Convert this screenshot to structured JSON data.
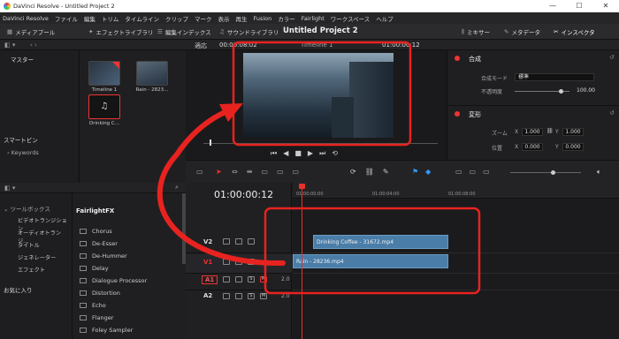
{
  "window": {
    "title": "DaVinci Resolve - Untitled Project 2",
    "minimize": "—",
    "maximize": "☐",
    "close": "✕"
  },
  "menu": [
    "DaVinci Resolve",
    "ファイル",
    "編集",
    "トリム",
    "タイムライン",
    "クリップ",
    "マーク",
    "表示",
    "再生",
    "Fusion",
    "カラー",
    "Fairlight",
    "ワークスペース",
    "ヘルプ"
  ],
  "toolbar": {
    "media_pool": "メディアプール",
    "effects_library": "エフェクトライブラリ",
    "edit_index": "編集インデックス",
    "sound_library": "サウンドライブラリ",
    "project_title": "Untitled Project 2",
    "mixer": "ミキサー",
    "metadata": "メタデータ",
    "inspector": "インスペクタ"
  },
  "media": {
    "header": "マスター",
    "clips": [
      {
        "name": "Timeline 1"
      },
      {
        "name": "Rain - 2823..."
      },
      {
        "name": "Drinking C..."
      }
    ]
  },
  "smart_bins": {
    "header": "スマートビン",
    "keywords": "Keywords"
  },
  "effects": {
    "toolbox": "ツールボックス",
    "items": [
      "ビデオトランジション",
      "オーディオトランジ...",
      "タイトル",
      "ジェネレーター",
      "エフェクト"
    ],
    "favorites": "お気に入り",
    "category": "FairlightFX",
    "fx": [
      "Chorus",
      "De-Esser",
      "De-Hummer",
      "Delay",
      "Dialogue Processor",
      "Distortion",
      "Echo",
      "Flanger",
      "Foley Sampler"
    ]
  },
  "viewer": {
    "fit": "適応",
    "timecode_left": "00:00:08:02",
    "timeline_name": "Timeline 1",
    "timecode_right": "01:00:00:12"
  },
  "timeline": {
    "timecode": "01:00:00:12",
    "ruler": [
      "01:00:00:00",
      "01:00:04:00",
      "01:00:08:00"
    ],
    "tracks": [
      {
        "name": "V2",
        "clip": "Drinking Coffee - 31672.mp4"
      },
      {
        "name": "V1",
        "clip": "Rain - 28236.mp4"
      },
      {
        "name": "A1",
        "level": "2.0"
      },
      {
        "name": "A2",
        "level": "2.0"
      }
    ]
  },
  "inspector": {
    "composite_header": "合成",
    "composite_mode_label": "合成モード",
    "composite_mode_value": "標準",
    "opacity_label": "不透明度",
    "opacity_value": "100.00",
    "transform_header": "変形",
    "zoom_label": "ズーム",
    "zoom_x": "1.000",
    "zoom_y": "1.000",
    "position_label": "位置",
    "pos_x": "0.000",
    "pos_y": "0.000",
    "x": "X",
    "y": "Y"
  },
  "colors": {
    "annotation_red": "#e8231f",
    "clip_blue": "#4a7da8",
    "playhead": "#e8312a"
  }
}
